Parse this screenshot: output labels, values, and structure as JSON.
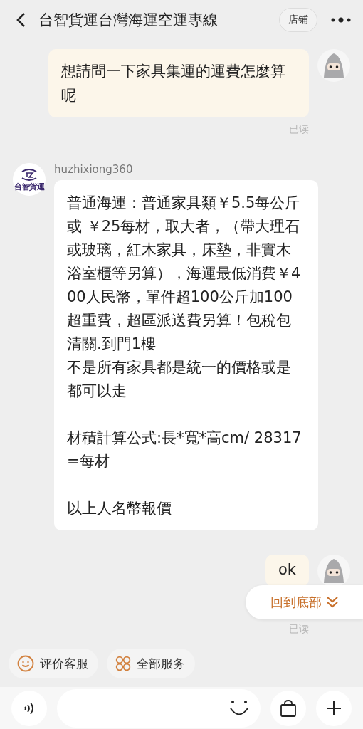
{
  "header": {
    "title": "台智貨運台灣海運空運專線",
    "shop_button": "店铺"
  },
  "messages": [
    {
      "kind": "sent",
      "paragraphs": [
        [
          "想請問一下家具集運的運費怎麼算呢"
        ]
      ],
      "status": "已读"
    },
    {
      "kind": "received",
      "sender": "huzhixiong360",
      "avatar_text": "台智貨運",
      "paragraphs": [
        [
          "普通海運：普通家具類￥5.5每公斤或 ￥25每材，取大者，（帶大理石或玻璃，紅木家具，床墊，非實木浴室櫃等另算），海運最低消費￥400人民幣，單件超100公斤加100超重費，超區派送費另算！包稅包清關.到門1樓",
          "不是所有家具都是統一的價格或是都可以走"
        ],
        [
          "材積計算公式:長*寬*高cm/ 28317=每材"
        ],
        [
          "以上人名幣報價"
        ]
      ]
    },
    {
      "kind": "sent",
      "paragraphs": [
        [
          "ok"
        ]
      ],
      "status": "已读"
    }
  ],
  "scroll_bottom_button": "回到底部",
  "quick_actions": [
    {
      "kind": "rate",
      "label": "评价客服"
    },
    {
      "kind": "services",
      "label": "全部服务"
    }
  ]
}
